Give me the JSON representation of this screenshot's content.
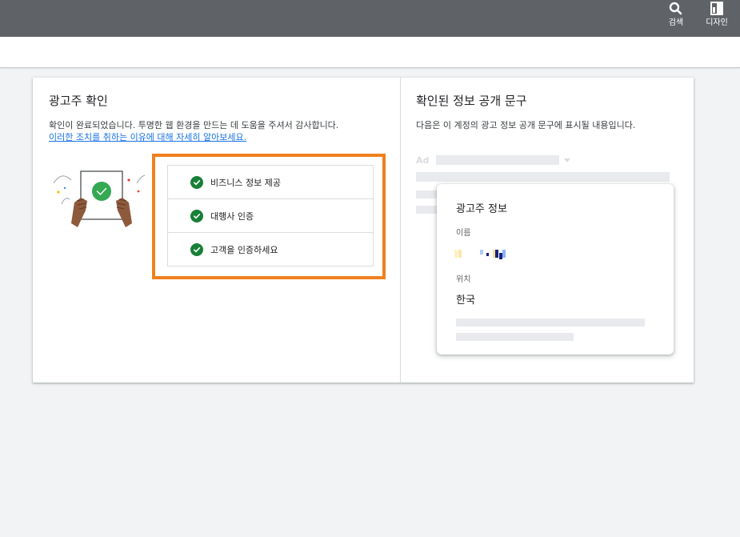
{
  "topbar": {
    "search_label": "검색",
    "design_label": "디자인"
  },
  "left": {
    "title": "광고주 확인",
    "description": "확인이 완료되었습니다. 투명한 웹 환경을 만드는 데 도움을 주셔서 감사합니다.",
    "link_text": "이러한 조치를 취하는 이유에 대해 자세히 알아보세요.",
    "steps": [
      {
        "label": "비즈니스 정보 제공",
        "icon": "check-circle-icon"
      },
      {
        "label": "대행사 인증",
        "icon": "check-circle-icon"
      },
      {
        "label": "고객을 인증하세요",
        "icon": "check-circle-icon"
      }
    ]
  },
  "right": {
    "title": "확인된 정보 공개 문구",
    "description": "다음은 이 계정의 광고 정보 공개 문구에 표시될 내용입니다.",
    "ad_tag": "Ad",
    "info_card": {
      "title": "광고주 정보",
      "name_label": "이름",
      "location_label": "위치",
      "location_value": "한국"
    }
  },
  "colors": {
    "topbar": "#5f6368",
    "highlight": "#f0801f",
    "check": "#188038",
    "link": "#1a73e8"
  }
}
